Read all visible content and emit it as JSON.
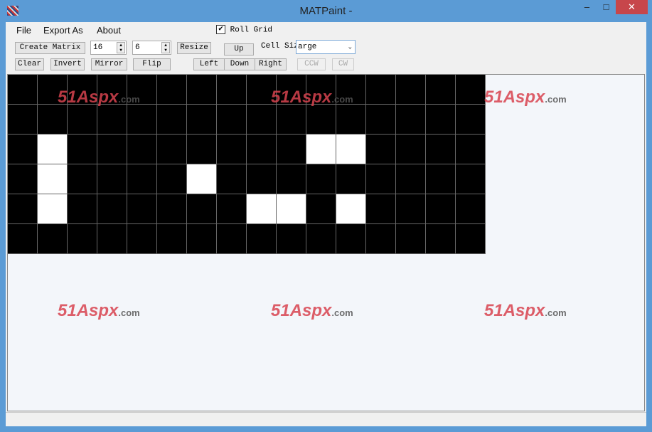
{
  "window": {
    "title": "MATPaint -",
    "minimize": "–",
    "maximize": "□",
    "close": "✕"
  },
  "menu": [
    "File",
    "Export As",
    "About"
  ],
  "toolbar": {
    "create_matrix": "Create Matrix",
    "width_value": "16",
    "height_value": "6",
    "resize": "Resize",
    "up": "Up",
    "cell_size_label": "Cell Size",
    "cell_size_value": "arge",
    "roll_grid": "Roll Grid",
    "roll_grid_checked": true,
    "clear": "Clear",
    "invert": "Invert",
    "mirror": "Mirror",
    "flip": "Flip",
    "left": "Left",
    "down": "Down",
    "right": "Right",
    "ccw": "CCW",
    "cw": "CW"
  },
  "matrix": {
    "columns": 16,
    "rows": 6,
    "on_cells": [
      [
        2,
        1
      ],
      [
        2,
        10
      ],
      [
        2,
        11
      ],
      [
        3,
        1
      ],
      [
        3,
        6
      ],
      [
        4,
        1
      ],
      [
        4,
        8
      ],
      [
        4,
        9
      ],
      [
        4,
        11
      ]
    ],
    "on_color": "#ffffff",
    "off_color": "#000000"
  },
  "watermark": {
    "text": "51Aspx",
    "suffix": ".com"
  }
}
